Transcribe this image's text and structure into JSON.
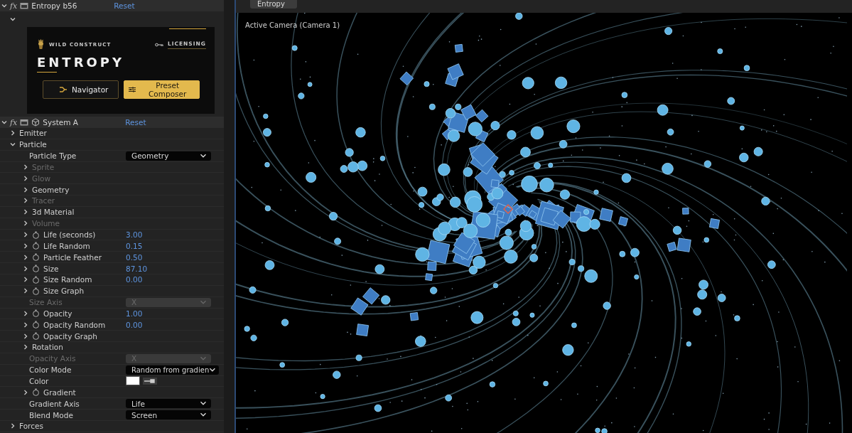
{
  "effect_header": {
    "fx": "fx",
    "name": "Entropy b56",
    "reset": "Reset",
    "expanded": true
  },
  "plugin_banner": {
    "brand": "WILD CONSTRUCT",
    "licensing": "LICENSING",
    "title": "ENTROPY",
    "buttons": [
      {
        "label": "Navigator",
        "selected": false
      },
      {
        "label": "Preset Composer",
        "selected": true
      }
    ]
  },
  "system_header": {
    "fx": "fx",
    "name": "System A",
    "reset": "Reset",
    "expanded": true
  },
  "properties": [
    {
      "kind": "group",
      "label": "Emitter",
      "expanded": false,
      "disabled": false
    },
    {
      "kind": "group",
      "label": "Particle",
      "expanded": true,
      "disabled": false,
      "children": [
        {
          "kind": "dropdown",
          "label": "Particle Type",
          "value": "Geometry",
          "disabled": false
        },
        {
          "kind": "group",
          "label": "Sprite",
          "expanded": false,
          "disabled": true
        },
        {
          "kind": "group",
          "label": "Glow",
          "expanded": false,
          "disabled": true
        },
        {
          "kind": "group",
          "label": "Geometry",
          "expanded": false,
          "disabled": false
        },
        {
          "kind": "group",
          "label": "Tracer",
          "expanded": false,
          "disabled": true
        },
        {
          "kind": "group",
          "label": "3d Material",
          "expanded": false,
          "disabled": false
        },
        {
          "kind": "group",
          "label": "Volume",
          "expanded": false,
          "disabled": true
        },
        {
          "kind": "param",
          "label": "Life (seconds)",
          "value": "3.00",
          "expanded": false,
          "disabled": false
        },
        {
          "kind": "param",
          "label": "Life Random",
          "value": "0.15",
          "expanded": false,
          "disabled": false
        },
        {
          "kind": "param",
          "label": "Particle Feather",
          "value": "0.50",
          "expanded": false,
          "disabled": false
        },
        {
          "kind": "param",
          "label": "Size",
          "value": "87.10",
          "expanded": false,
          "disabled": false
        },
        {
          "kind": "param",
          "label": "Size Random",
          "value": "0.00",
          "expanded": false,
          "disabled": false
        },
        {
          "kind": "param",
          "label": "Size Graph",
          "expanded": false,
          "disabled": false
        },
        {
          "kind": "dropdown",
          "label": "Size Axis",
          "value": "X",
          "disabled": true
        },
        {
          "kind": "param",
          "label": "Opacity",
          "value": "1.00",
          "expanded": false,
          "disabled": false
        },
        {
          "kind": "param",
          "label": "Opacity Random",
          "value": "0.00",
          "expanded": false,
          "disabled": false
        },
        {
          "kind": "param",
          "label": "Opacity Graph",
          "expanded": false,
          "disabled": false
        },
        {
          "kind": "group",
          "label": "Rotation",
          "expanded": false,
          "disabled": false
        },
        {
          "kind": "dropdown",
          "label": "Opacity Axis",
          "value": "X",
          "disabled": true
        },
        {
          "kind": "dropdown",
          "label": "Color Mode",
          "value": "Random from gradien",
          "disabled": false
        },
        {
          "kind": "color",
          "label": "Color",
          "color": "#ffffff",
          "disabled": false
        },
        {
          "kind": "param",
          "label": "Gradient",
          "expanded": false,
          "disabled": false
        },
        {
          "kind": "dropdown",
          "label": "Gradient Axis",
          "value": "Life",
          "disabled": false
        },
        {
          "kind": "dropdown",
          "label": "Blend Mode",
          "value": "Screen",
          "disabled": false
        }
      ]
    },
    {
      "kind": "group",
      "label": "Forces",
      "expanded": false,
      "disabled": false
    }
  ],
  "viewer": {
    "tab": "Entropy",
    "camera_label": "Active Camera (Camera 1)"
  }
}
